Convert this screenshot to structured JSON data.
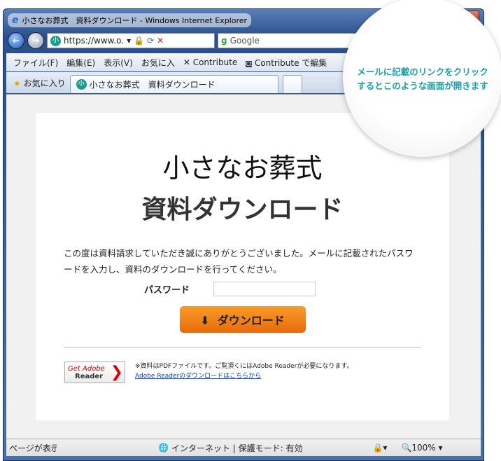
{
  "window": {
    "title": "小さなお葬式　資料ダウンロード - Windows Internet Explorer"
  },
  "nav": {
    "address": "https://www.o.",
    "search": "Google"
  },
  "menu": [
    "ファイル(F)",
    "編集(E)",
    "表示(V)",
    "お気に入"
  ],
  "toolbar_links": [
    "Contribute",
    "Contribute で編集"
  ],
  "tabs": {
    "favorites": "お気に入り",
    "active": "小さなお葬式　資料ダウンロード"
  },
  "page": {
    "title1": "小さなお葬式",
    "title2": "資料ダウンロード",
    "description": "この度は資料請求していただき誠にありがとうございました。メールに記載されたパスワードを入力し、資料のダウンロードを行ってください。",
    "password_label": "パスワード",
    "password_value": "",
    "download_button": "ダウンロード",
    "adobe_badge_get": "Get Adobe",
    "adobe_badge_reader": "Reader",
    "adobe_note": "※資料はPDFファイルです。ご覧頂くにはAdobe Readerが必要になります。",
    "adobe_link": "Adobe Readerのダウンロードはこちらから"
  },
  "status": {
    "left": "ページが表示",
    "zone": "インターネット | 保護モード: 有効",
    "zoom": "100%"
  },
  "callout": {
    "line1": "メールに記載のリンクをクリック",
    "line2": "するとこのような画面が開きます"
  },
  "colors": {
    "accent": "#1aa0a6",
    "button": "#f08a1a"
  }
}
